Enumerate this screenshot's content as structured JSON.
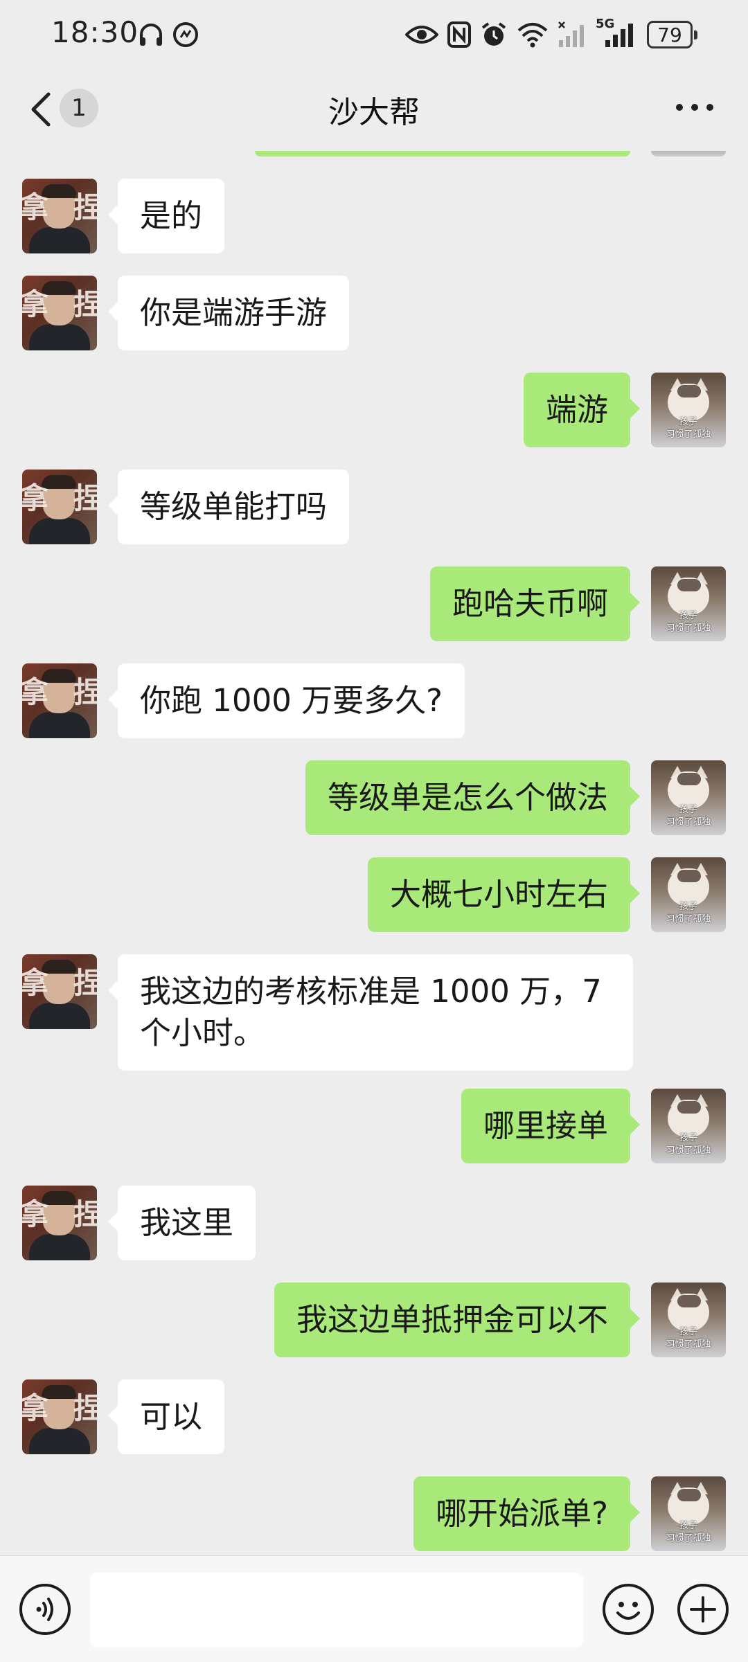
{
  "status_bar": {
    "time": "18:30",
    "battery": "79",
    "network": "5G"
  },
  "header": {
    "title": "沙大帮",
    "unread_count": "1"
  },
  "avatars": {
    "contact_char_1": "拿",
    "contact_char_2": "捏",
    "self_caption_1": "孩子",
    "self_caption_2": "习惯了孤独"
  },
  "messages": [
    {
      "side": "left",
      "text": "是的"
    },
    {
      "side": "left",
      "text": "你是端游手游"
    },
    {
      "side": "right",
      "text": "端游"
    },
    {
      "side": "left",
      "text": "等级单能打吗"
    },
    {
      "side": "right",
      "text": "跑哈夫币啊"
    },
    {
      "side": "left",
      "text": "你跑 1000 万要多久?"
    },
    {
      "side": "right",
      "text": "等级单是怎么个做法"
    },
    {
      "side": "right",
      "text": "大概七小时左右"
    },
    {
      "side": "left",
      "text": "我这边的考核标准是 1000 万，7 个小时。"
    },
    {
      "side": "right",
      "text": "哪里接单"
    },
    {
      "side": "left",
      "text": "我这里"
    },
    {
      "side": "right",
      "text": "我这边单抵押金可以不"
    },
    {
      "side": "left",
      "text": "可以"
    },
    {
      "side": "right",
      "text": "哪开始派单?"
    }
  ],
  "input": {
    "placeholder": ""
  },
  "icons": {
    "back": "chevron-left-icon",
    "more": "more-dots-icon",
    "voice": "voice-icon",
    "emoji": "emoji-icon",
    "plus": "plus-icon"
  },
  "colors": {
    "background": "#ededed",
    "sent_bubble": "#a9e97a",
    "received_bubble": "#ffffff"
  }
}
